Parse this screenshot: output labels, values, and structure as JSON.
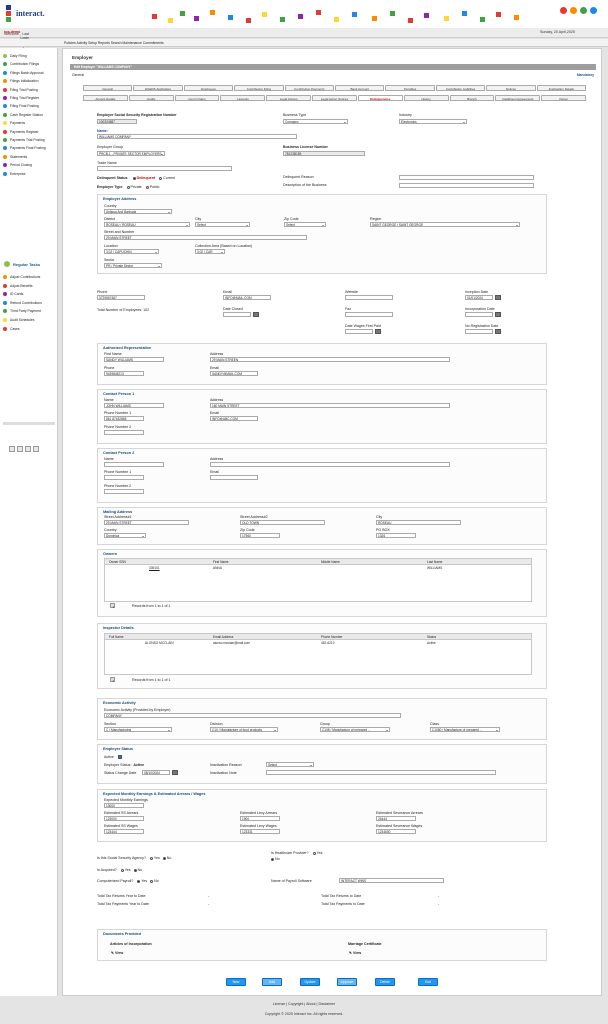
{
  "app": {
    "logo_text": "interact."
  },
  "topbar": {
    "welcome": "Welcome",
    "user": "ros-demo",
    "last_login": ", Last Login on: 19 April, 2025 04:56:29",
    "date": "Sunday, 20 April,2025"
  },
  "menu": {
    "items": "Policies   Activity   Setup   Reports   Search   Maintenance   Commitments"
  },
  "sidebar": {
    "items": [
      "Daily Filing",
      "Contribution Filings",
      "Filings Batch Approval",
      "Filings Initialization",
      "Filing Trial Posting",
      "Filing Trial Register",
      "Filing Final Posting",
      "Cash Register Station",
      "Payments",
      "Payments Register",
      "Payments Trial Posting",
      "Payments Final Posting",
      "Statements",
      "Period Closing",
      "Enterprise"
    ],
    "group_label": "Regular Tasks",
    "group_items": [
      "Adjust Contributions",
      "Adjust Benefits",
      "ID Cards",
      "Refund Contributions",
      "Third Party Payment",
      "Audit Schedules",
      "Cases"
    ]
  },
  "page": {
    "title": "Employer",
    "edit_bar": "Edit Employer \"WILLIAMS COMPANY\"",
    "general": "General",
    "mandatory": "Mandatory"
  },
  "tabs_row1": [
    "General",
    "EGERS Application",
    "Employees",
    "Contribution Filing",
    "Contribution Payments",
    "Bank Account",
    "Penalties",
    "Contribution Liabilities",
    "Notices",
    "Inactivation Details"
  ],
  "tabs_row2": [
    "Arrears Details",
    "Audits",
    "Court Orders",
    "Lawsuits",
    "Legal Actions",
    "Legal Action Notices",
    "Delinquencies",
    "History",
    "Branch",
    "Installment Agreements",
    "Owner"
  ],
  "general": {
    "ssrn_label": "Employer Social Security Registration Number",
    "ssrn": "100324587",
    "business_type_label": "Business Type",
    "business_type": "Company",
    "industry_label": "Industry",
    "industry": "Electronics",
    "name_label": "Name:",
    "name": "WILLIAMS COMPANY",
    "group_label": "Employer Group",
    "group": "PRCB-1 - PRIVATE SECTOR EMPLOYERS",
    "license_label": "Business License Number",
    "license": "78123B159",
    "trade_label": "Trade Name",
    "delinquent_label": "Delinquent Status",
    "delinquent_opt": "Delinquent",
    "current_opt": "Current",
    "delinquent_reason_label": "Delinquent Reason",
    "type_label": "Employer Type",
    "private_opt": "Private",
    "public_opt": "Public",
    "desc_label": "Description of the Business"
  },
  "address": {
    "legend": "Employer Address",
    "country_label": "Country",
    "country": "Antigua And Barbuda",
    "district_label": "District",
    "district": "ROSEAU / ROSEAU",
    "city_label": "City",
    "city": "Select",
    "zip_label": "Zip Code",
    "zip": "Select",
    "region_label": "Region",
    "region": "SAINT GEORGE / SAINT GEORGE",
    "street_label": "Street and Number",
    "street": "29 MAIN STREET",
    "location_label": "Location",
    "location": "3.02 / CAPUCHIN",
    "collection_label": "Collection Area (Based on Location)",
    "collection": "3.02 / CAR",
    "sector_label": "Sector",
    "sector": "PR / Private Sector"
  },
  "contact": {
    "phone_label": "Phone",
    "phone": "3729567487",
    "email_label": "Email",
    "email": "INFO@MAIL.COM",
    "website_label": "Website",
    "inception_label": "Inception Date",
    "inception": "01/01/2024",
    "total_emp": "Total Number of Employees: 102",
    "date_closed_label": "Date Closed",
    "fax_label": "Fax",
    "incorporation_label": "Incorporation Date",
    "wages_label": "Date Wages First Paid",
    "no_reg_label": "No Registration Date"
  },
  "auth": {
    "legend": "Authorized Representative",
    "fname_label": "First Name",
    "fname": "SANDY WILLIAMS",
    "addr_label": "Address",
    "addr": "29 MAIN STREEN",
    "phone_label": "Phone",
    "phone": "9439845213",
    "email_label": "Email",
    "email": "SANDY@MAIL.COM"
  },
  "cp1": {
    "legend": "Contact Person 1",
    "name_label": "Name",
    "name": "JOHN WILLIAMS",
    "addr_label": "Address",
    "addr": "160 MAIN STREET",
    "ph1_label": "Phone Number 1",
    "ph1": "861 87432865",
    "email_label": "Email",
    "email": "INFO@ABC.COM",
    "ph2_label": "Phone Number 2"
  },
  "cp2": {
    "legend": "Contact Person 2",
    "name_label": "Name",
    "addr_label": "Address",
    "ph1_label": "Phone Number 1",
    "email_label": "Email",
    "ph2_label": "Phone Number 2"
  },
  "mailing": {
    "legend": "Mailing Address",
    "s1_label": "Street Address#1",
    "s1": "29 MAIN STREET",
    "s2_label": "Street Address#2",
    "s2": "OLD TOWN",
    "city_label": "City",
    "city": "ROSEAU",
    "country_label": "Country",
    "country": "Dominica",
    "zip_label": "Zip Code",
    "zip": "17960",
    "po_label": "PO BOX",
    "po": "1326"
  },
  "owners": {
    "legend": "Owners",
    "headers": [
      "Owner SSN",
      "First Name",
      "Middle Name",
      "Last Name"
    ],
    "row": [
      "339101",
      "ANNA",
      "",
      "WILLIAMS"
    ],
    "records": "Records from 1 to 1 of 1",
    "page": "1"
  },
  "inspector": {
    "legend": "Inspector Details",
    "headers": [
      "Full Name",
      "Email Address",
      "Phone Number",
      "Status"
    ],
    "row": [
      "ALONSO MCCLAIN",
      "alonso.mcclain@mail.com",
      "462-6210",
      "Active"
    ],
    "records": "Records from 1 to 1 of 1",
    "page": "1"
  },
  "economic": {
    "legend": "Economic Activity",
    "provided_label": "Economic Activity (Provided by Employer)",
    "provided": "COMPANY",
    "section_label": "Section",
    "section": "C / Manufacturing",
    "division_label": "Division",
    "division": "C10 / Manufacture of food products",
    "group_label": "Group",
    "group": "C108 / Manufacture of prepared ...",
    "class_label": "Class",
    "class": "C1080 / Manufacture of prepared ..."
  },
  "status": {
    "legend": "Employer Status",
    "active_label": "Active",
    "emp_status": "Employer Status : ",
    "emp_status_val": "Active",
    "inact_reason_label": "Inactivation Reason",
    "inact_reason": "Select",
    "change_label": "Status Change Date",
    "change": "08/10/2024",
    "inact_note_label": "Inactivation Note"
  },
  "earnings": {
    "legend": "Expected Monthly Earnings & Estimated Arrears / Wages",
    "eme_label": "Expected Monthly Earnings",
    "eme": "19000",
    "ssa_label": "Estimated SS Arrears",
    "ssa": "123000",
    "la_label": "Estimated Levy Arrears",
    "la": "1900",
    "sva_label": "Estimated Severance Arrears",
    "sva": "24444",
    "ssw_label": "Estimated SS Wages",
    "ssw": "123444",
    "lw_label": "Estimated Levy Wages",
    "lw": "123331",
    "svw_label": "Estimated Severance Wages",
    "svw": "1234600"
  },
  "misc": {
    "ss_agency": "Is this Social Security Agency?",
    "yes": "Yes",
    "no": "No",
    "healthcare": "Is Healthcare Provider?",
    "acquired": "Is Acquired?",
    "comp_payroll": "Computerized Payroll?",
    "payroll_sw_label": "Name of Payroll Software",
    "payroll_sw": "INTERACT WINS",
    "t1": "Total Tax Returns Year to Date",
    "t2": "Total Tax Payments Year to Date",
    "t3": "Total Tax Returns to Date",
    "t4": "Total Tax Payments to Date",
    "dash": "-"
  },
  "docs": {
    "legend": "Documents Provided",
    "art_label": "Articles of Incorporation",
    "marr_label": "Marriage Certificate",
    "view": "View"
  },
  "buttons": [
    "New",
    "Add",
    "Update",
    "Approve",
    "Delete",
    "Exit"
  ],
  "footer": {
    "links": "License | Copyright | About | Disclaimer",
    "copy": "Copyright © 2025 Interact Inc. All rights reserved."
  }
}
